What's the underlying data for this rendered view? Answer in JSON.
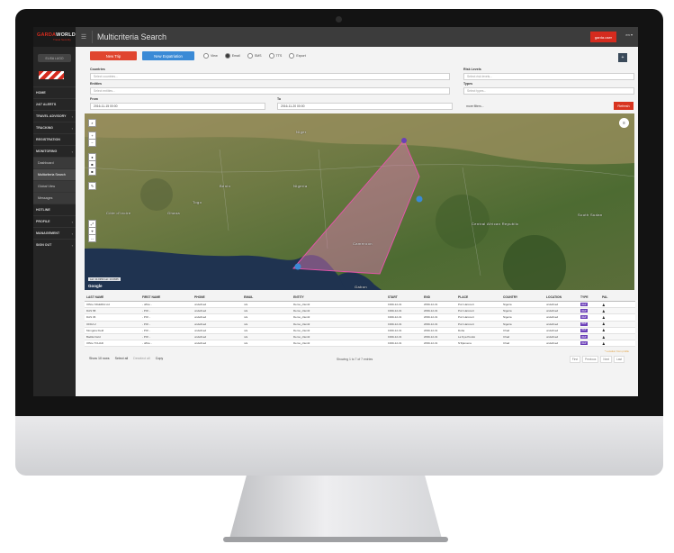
{
  "brand": {
    "name_prefix": "GARDA",
    "name_suffix": "WORLD",
    "tagline": "Travel Security"
  },
  "sidebar": {
    "user_button": "ELISA LUGO",
    "items": [
      {
        "label": "HOME",
        "chevron": false,
        "sub": false
      },
      {
        "label": "24/7 ALERTS",
        "chevron": false,
        "sub": false
      },
      {
        "label": "TRAVEL ADVISORY",
        "chevron": true,
        "sub": false
      },
      {
        "label": "TRACKING",
        "chevron": true,
        "sub": false
      },
      {
        "label": "REGISTRATION",
        "chevron": false,
        "sub": false
      },
      {
        "label": "MONITORING",
        "chevron": true,
        "sub": false
      },
      {
        "label": "Dashboard",
        "chevron": false,
        "sub": true
      },
      {
        "label": "Multicriteria Search",
        "chevron": false,
        "sub": true,
        "active": true
      },
      {
        "label": "Global View",
        "chevron": false,
        "sub": true
      },
      {
        "label": "Messages",
        "chevron": false,
        "sub": true
      },
      {
        "label": "HOTLINE",
        "chevron": false,
        "sub": false
      },
      {
        "label": "PROFILE",
        "chevron": true,
        "sub": false
      },
      {
        "label": "MANAGEMENT",
        "chevron": true,
        "sub": false
      },
      {
        "label": "SIGN OUT",
        "chevron": true,
        "sub": false
      }
    ]
  },
  "topbar": {
    "menu_icon": "☰",
    "title": "Multicriteria Search",
    "user": "garda.user",
    "lang": "en ▾"
  },
  "toolbar": {
    "new_trip": "New Trip",
    "new_expatriation": "New Expatriation",
    "radios": [
      {
        "label": "View",
        "on": false
      },
      {
        "label": "Email",
        "on": true
      },
      {
        "label": "SMS",
        "on": false
      },
      {
        "label": "TTS",
        "on": false
      },
      {
        "label": "Export",
        "on": false
      }
    ]
  },
  "filters": {
    "countries_label": "Countries",
    "countries_placeholder": "Select countries...",
    "entities_label": "Entities",
    "entities_placeholder": "Select entities...",
    "from_label": "From",
    "from_value": "2016-11-15 00:00",
    "to_label": "To",
    "to_value": "2016-11-20 00:00",
    "risk_label": "Risk Levels",
    "risk_placeholder": "Select risk levels...",
    "types_label": "Types",
    "types_placeholder": "Select types...",
    "more_filters": "more filters...",
    "refresh": "Refresh"
  },
  "map": {
    "labels": [
      {
        "text": "Niger",
        "pos": "n1"
      },
      {
        "text": "Benin",
        "pos": "n2"
      },
      {
        "text": "Nigeria",
        "pos": "n3"
      },
      {
        "text": "Togo",
        "pos": "n4"
      },
      {
        "text": "Côte d'Ivoire",
        "pos": "n5"
      },
      {
        "text": "Ghana",
        "pos": "n6"
      },
      {
        "text": "Cameroon",
        "pos": "n7"
      },
      {
        "text": "Central African Republic",
        "pos": "n8"
      },
      {
        "text": "South Sudan",
        "pos": "n9"
      },
      {
        "text": "Gabon",
        "pos": "n10"
      }
    ],
    "coord_readout": "Lat: 11.1952 Lat: 13.0665",
    "google": "Google"
  },
  "table": {
    "columns": [
      "LAST NAME",
      "FIRST NAME",
      "PHONE",
      "EMAIL",
      "ENTITY",
      "START",
      "END",
      "PLACE",
      "COUNTRY",
      "LOCATION",
      "TYPE",
      "PAL"
    ],
    "rows": [
      [
        "Office NIGERIA Ltd",
        "- office -",
        "undefined",
        "n/a",
        "Demo_client2",
        "1999-12-31",
        "2099-12-31",
        "Port Harcourt",
        "Nigeria",
        "undefined",
        "REP",
        "♟"
      ],
      [
        "DAS 58",
        "- POI -",
        "undefined",
        "n/a",
        "Demo_client2",
        "1999-12-31",
        "2099-12-31",
        "Port Harcourt",
        "Nigeria",
        "undefined",
        "REP",
        "♟"
      ],
      [
        "DAS 36",
        "- POI -",
        "undefined",
        "n/a",
        "Demo_client2",
        "1999-12-31",
        "2099-12-31",
        "Port Harcourt",
        "Nigeria",
        "undefined",
        "REP",
        "♟"
      ],
      [
        "OFDA 2",
        "- POI -",
        "undefined",
        "n/a",
        "Demo_client2",
        "1999-12-31",
        "2099-12-31",
        "Port Harcourt",
        "Nigeria",
        "undefined",
        "REP",
        "♟"
      ],
      [
        "Mongara Field",
        "- POI -",
        "undefined",
        "n/a",
        "Demo_client2",
        "1999-12-31",
        "2099-12-31",
        "Doba",
        "Chad",
        "undefined",
        "REP",
        "♟"
      ],
      [
        "Badila Field",
        "- POI -",
        "undefined",
        "n/a",
        "Demo_client2",
        "1999-12-31",
        "2099-12-31",
        "La Nya Pendé",
        "Chad",
        "undefined",
        "REP",
        "♟"
      ],
      [
        "Office TCHAD",
        "- office -",
        "undefined",
        "n/a",
        "Demo_client2",
        "1999-12-31",
        "2099-12-31",
        "N'Djamena",
        "Chad",
        "undefined",
        "REP",
        "♟"
      ]
    ],
    "note": "* Location from profile"
  },
  "footer": {
    "show_rows": "Show 10 rows",
    "select_all": "Select all",
    "deselect_all": "Deselect all",
    "copy": "Copy",
    "showing": "Showing 1 to 7 of 7 entries",
    "pager": [
      "First",
      "Previous",
      "Next",
      "Last"
    ]
  }
}
